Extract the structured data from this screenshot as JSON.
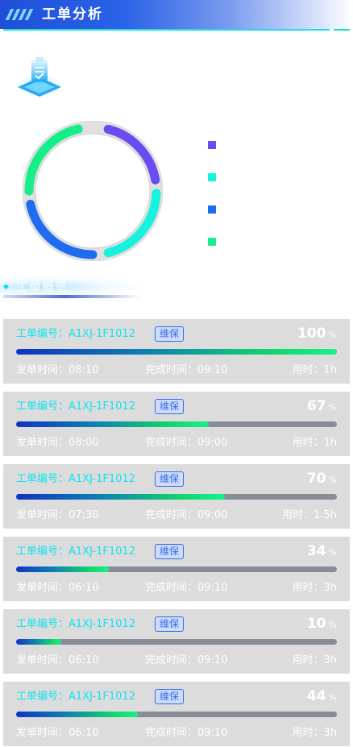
{
  "header": {
    "title": "工单分析"
  },
  "donut": {
    "colors": {
      "track": "#e0e0e0",
      "purple": "#6a4cf0",
      "cyan": "#17f1de",
      "blue": "#1f6cf0",
      "green": "#16ee8a"
    }
  },
  "legend": {
    "items": [
      {
        "color": "#6a4cf0",
        "label": ""
      },
      {
        "color": "#17f1de",
        "label": ""
      },
      {
        "color": "#1f6cf0",
        "label": ""
      },
      {
        "color": "#16ee8a",
        "label": ""
      }
    ]
  },
  "section": {
    "title": "工单概览"
  },
  "orders": [
    {
      "id_label": "工单编号：A1XJ-1F1012",
      "tag": "维保",
      "percent": "100",
      "unit": "%",
      "progress": 100,
      "send": "发单时间：08:10",
      "done": "完成时间：09:10",
      "duration": "用时：1h"
    },
    {
      "id_label": "工单编号：A1XJ-1F1012",
      "tag": "维保",
      "percent": "67",
      "unit": "%",
      "progress": 60,
      "send": "发单时间：08:00",
      "done": "完成时间：09:00",
      "duration": "用时：1h"
    },
    {
      "id_label": "工单编号：A1XJ-1F1012",
      "tag": "维保",
      "percent": "70",
      "unit": "%",
      "progress": 65,
      "send": "发单时间：07:30",
      "done": "完成时间：09:00",
      "duration": "用时：1.5h"
    },
    {
      "id_label": "工单编号：A1XJ-1F1012",
      "tag": "维保",
      "percent": "34",
      "unit": "%",
      "progress": 29,
      "send": "发单时间：06:10",
      "done": "完成时间：09:10",
      "duration": "用时：3h"
    },
    {
      "id_label": "工单编号：A1XJ-1F1012",
      "tag": "维保",
      "percent": "10",
      "unit": "%",
      "progress": 14,
      "send": "发单时间：06:10",
      "done": "完成时间：09:10",
      "duration": "用时：3h"
    },
    {
      "id_label": "工单编号：A1XJ-1F1012",
      "tag": "维保",
      "percent": "44",
      "unit": "%",
      "progress": 38,
      "send": "发单时间：06:10",
      "done": "完成时间：09:10",
      "duration": "用时：3h"
    }
  ]
}
